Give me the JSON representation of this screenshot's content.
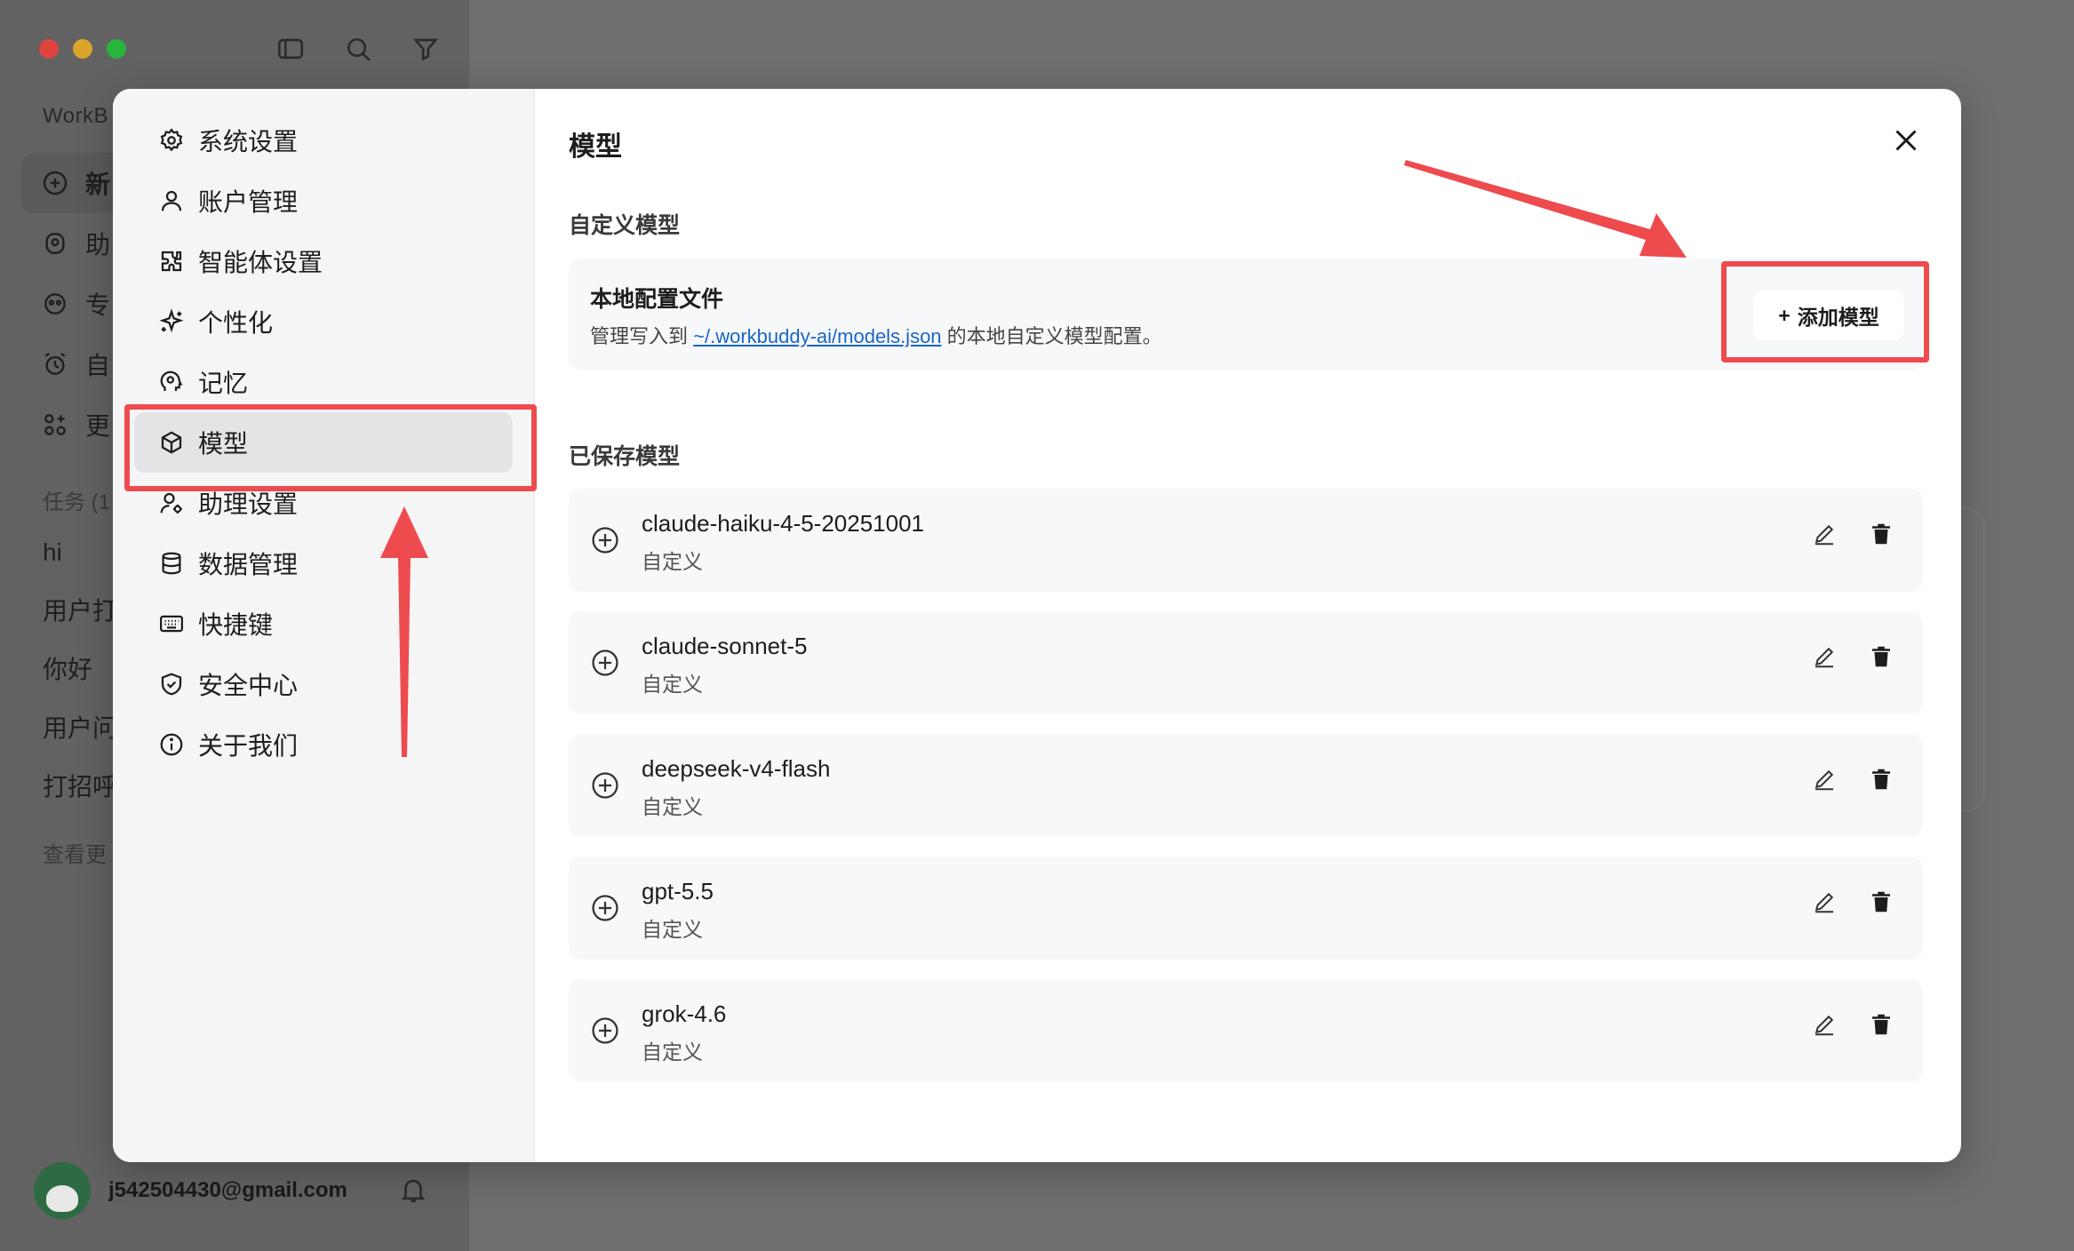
{
  "background": {
    "brand_partial": "WorkB",
    "menu": [
      "新",
      "助",
      "专",
      "自",
      "更"
    ],
    "tasks_label": "任务 (1",
    "tasks": [
      "hi",
      "用户打",
      "你好",
      "用户问",
      "打招呼"
    ],
    "more": "查看更",
    "user_email": "j542504430@gmail.com"
  },
  "sidebar": {
    "items": [
      {
        "label": "系统设置",
        "icon": "gear-icon"
      },
      {
        "label": "账户管理",
        "icon": "user-icon"
      },
      {
        "label": "智能体设置",
        "icon": "puzzle-icon"
      },
      {
        "label": "个性化",
        "icon": "sparkle-icon"
      },
      {
        "label": "记忆",
        "icon": "brain-icon"
      },
      {
        "label": "模型",
        "icon": "cube-icon",
        "active": true
      },
      {
        "label": "助理设置",
        "icon": "user-gear-icon"
      },
      {
        "label": "数据管理",
        "icon": "database-icon"
      },
      {
        "label": "快捷键",
        "icon": "keyboard-icon"
      },
      {
        "label": "安全中心",
        "icon": "shield-icon"
      },
      {
        "label": "关于我们",
        "icon": "info-icon"
      }
    ]
  },
  "main": {
    "title": "模型",
    "custom_section": "自定义模型",
    "config": {
      "title": "本地配置文件",
      "desc_before": "管理写入到 ",
      "link": "~/.workbuddy-ai/models.json",
      "desc_after": " 的本地自定义模型配置。"
    },
    "add_button": {
      "plus": "+",
      "label": "添加模型"
    },
    "saved_section": "已保存模型",
    "models": [
      {
        "name": "claude-haiku-4-5-20251001",
        "type": "自定义"
      },
      {
        "name": "claude-sonnet-5",
        "type": "自定义"
      },
      {
        "name": "deepseek-v4-flash",
        "type": "自定义"
      },
      {
        "name": "gpt-5.5",
        "type": "自定义"
      },
      {
        "name": "grok-4.6",
        "type": "自定义"
      }
    ]
  },
  "colors": {
    "annotation_red": "#ee4b4f",
    "link_blue": "#1a66c8",
    "active_bg": "#e4e4e6"
  }
}
